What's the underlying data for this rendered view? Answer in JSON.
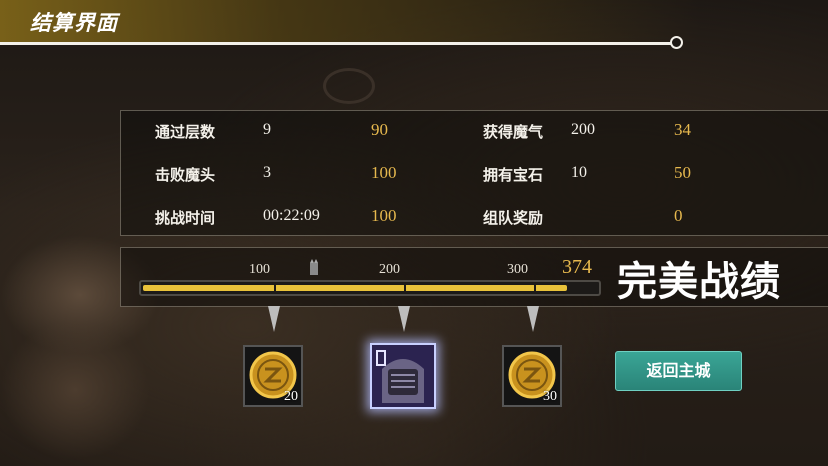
{
  "title": "结算界面",
  "stats": {
    "rows": [
      {
        "label": "通过层数",
        "value": "9",
        "score": "90"
      },
      {
        "label": "击败魔头",
        "value": "3",
        "score": "100"
      },
      {
        "label": "挑战时间",
        "value": "00:22:09",
        "score": "100"
      },
      {
        "label": "获得魔气",
        "value": "200",
        "score": "34"
      },
      {
        "label": "拥有宝石",
        "value": "10",
        "score": "50"
      },
      {
        "label": "组队奖励",
        "value": "",
        "score": "0"
      }
    ]
  },
  "progress": {
    "ticks": [
      "100",
      "200",
      "300"
    ],
    "total": "374",
    "max": 400,
    "current": 374,
    "rank": "完美战绩"
  },
  "rewards": [
    {
      "icon": "gold-coin-icon",
      "count": "20",
      "selected": false
    },
    {
      "icon": "armored-helmet-icon",
      "count": "",
      "selected": true
    },
    {
      "icon": "gold-coin-icon",
      "count": "30",
      "selected": false
    }
  ],
  "buttons": {
    "return_label": "返回主城"
  },
  "colors": {
    "score": "#e7b94e",
    "accent_button": "#3aa596",
    "bar": "#e9c23a"
  }
}
